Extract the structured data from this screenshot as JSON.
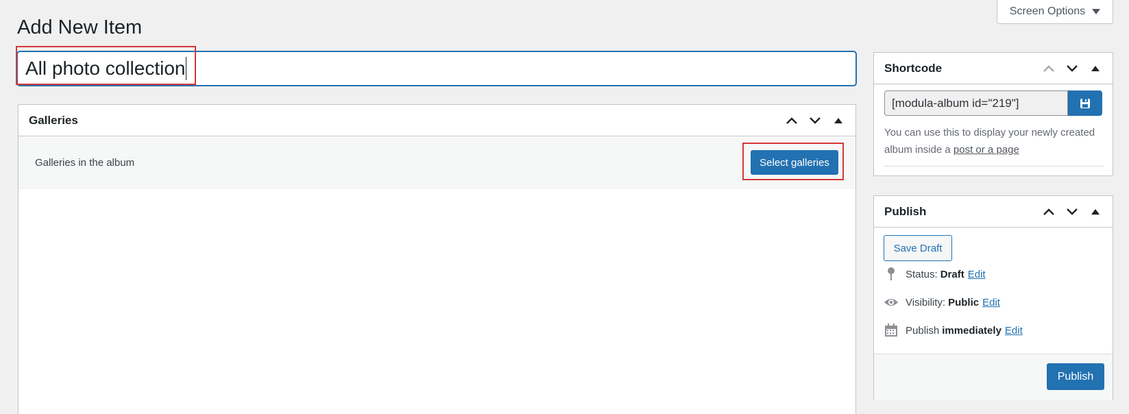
{
  "screen_options": {
    "label": "Screen Options",
    "icon": "caret-down-icon"
  },
  "page_title": "Add New Item",
  "title_input": {
    "value": "All photo collection"
  },
  "galleries": {
    "title": "Galleries",
    "bar_label": "Galleries in the album",
    "select_button": "Select galleries"
  },
  "shortcode": {
    "title": "Shortcode",
    "value": "[modula-album id=\"219\"]",
    "copy_icon": "copy-icon",
    "help_text": "You can use this to display your newly created album inside a",
    "help_link": "post or a page"
  },
  "publish": {
    "title": "Publish",
    "save_draft": "Save Draft",
    "status_label": "Status:",
    "status_value": "Draft",
    "visibility_label": "Visibility:",
    "visibility_value": "Public",
    "schedule_label": "Publish",
    "schedule_value": "immediately",
    "edit_label": "Edit",
    "publish_button": "Publish"
  },
  "colors": {
    "accent": "#2271b1",
    "highlight": "#d63638",
    "background": "#f0f0f1"
  }
}
